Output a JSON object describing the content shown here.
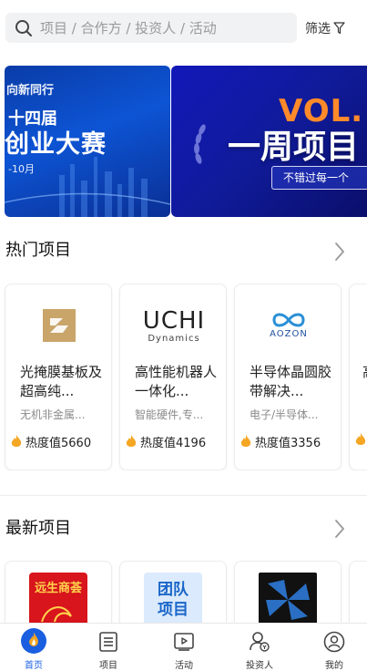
{
  "search": {
    "placeholder": "项目 / 合作方 / 投资人 / 活动",
    "filter_label": "筛选"
  },
  "banners": [
    {
      "line1": "向新同行",
      "line2": "十四届",
      "line3": "创业大赛",
      "line4": "-10月"
    },
    {
      "badge": "VOL.",
      "headline": "一周项目",
      "sub": "不错过每一个"
    }
  ],
  "hot": {
    "title": "热门项目",
    "cards": [
      {
        "name": "光掩膜基板及超高纯...",
        "tags": "无机非金属...",
        "heat": "热度值5660"
      },
      {
        "name": "高性能机器人一体化...",
        "tags": "智能硬件,专...",
        "heat": "热度值4196",
        "logo_text": "UCHI",
        "logo_sub": "Dynamics"
      },
      {
        "name": "半导体晶圆胶带解决...",
        "tags": "电子/半导体...",
        "heat": "热度值3356",
        "logo_text": "AOZON"
      },
      {
        "name": "高",
        "tags": "",
        "heat": ""
      }
    ]
  },
  "latest": {
    "title": "最新项目",
    "cards": [
      {
        "logo_text": "远生商荟"
      },
      {
        "logo_text": "团队项目"
      },
      {
        "logo_text": ""
      }
    ]
  },
  "tabs": [
    {
      "label": "首页",
      "icon": "home-icon",
      "active": true
    },
    {
      "label": "项目",
      "icon": "document-icon",
      "active": false
    },
    {
      "label": "活动",
      "icon": "play-icon",
      "active": false
    },
    {
      "label": "投资人",
      "icon": "investor-icon",
      "active": false
    },
    {
      "label": "我的",
      "icon": "profile-icon",
      "active": false
    }
  ],
  "colors": {
    "accent": "#1a5fe0",
    "flame": "#f5a623"
  }
}
